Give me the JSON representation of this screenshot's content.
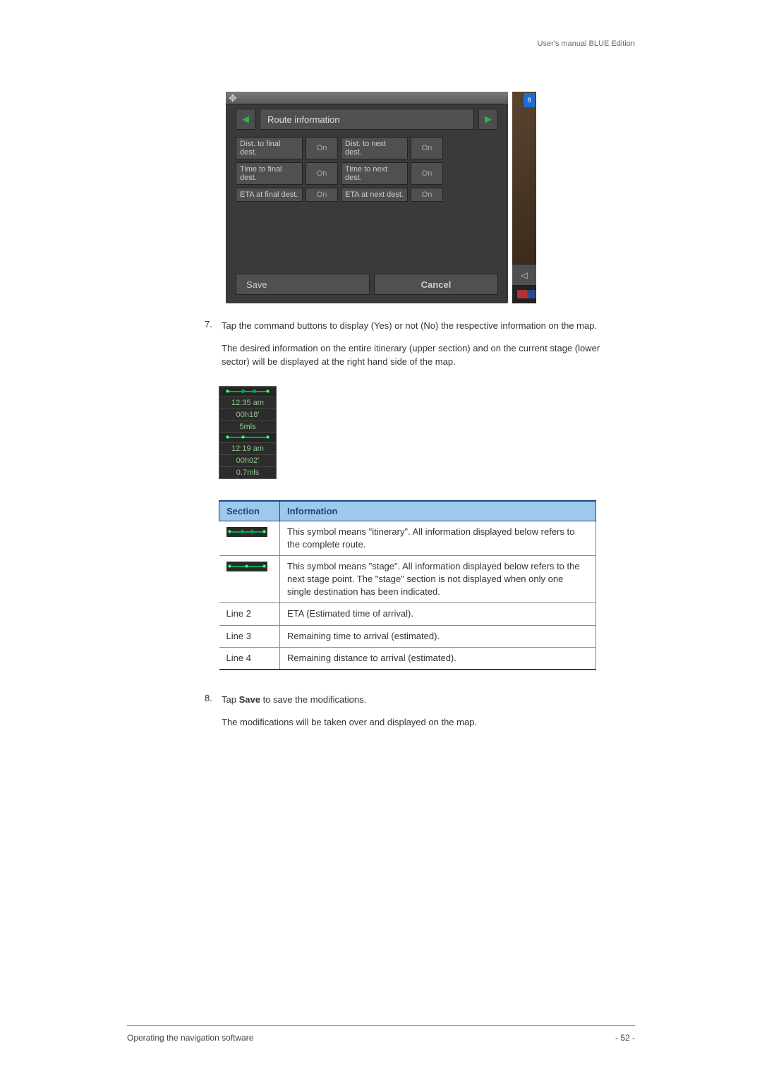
{
  "header_right": "User's manual BLUE Edition",
  "screenshot": {
    "title": "Route information",
    "rows": [
      {
        "l1": "Dist. to final dest.",
        "v1": "On",
        "l2": "Dist. to next dest.",
        "v2": "On"
      },
      {
        "l1": "Time to final dest.",
        "v1": "On",
        "l2": "Time to next dest.",
        "v2": "On"
      },
      {
        "l1": "ETA at final dest.",
        "v1": "On",
        "l2": "ETA at next dest.",
        "v2": "On"
      }
    ],
    "save": "Save",
    "cancel": "Cancel",
    "badge": "8"
  },
  "step7": {
    "num": "7.",
    "p1": "Tap the command buttons to display (Yes) or not (No) the respective information on the map.",
    "p2": "The desired information on the entire itinerary (upper section) and on the current stage (lower sector) will be displayed at the right hand side of the map."
  },
  "strip": {
    "a1": "12:35 am",
    "a2": "00h18'",
    "a3": "5mls",
    "b1": "12:19 am",
    "b2": "00h02'",
    "b3": "0.7mls"
  },
  "table": {
    "h1": "Section",
    "h2": "Information",
    "rows": [
      {
        "section": "",
        "info": "This symbol means \"itinerary\". All information displayed below refers to the complete route."
      },
      {
        "section": "",
        "info": "This symbol means \"stage\". All information displayed below refers to the next stage point. The \"stage\" section is not displayed when only one single destination has been indicated."
      },
      {
        "section": "Line 2",
        "info": "ETA (Estimated time of arrival)."
      },
      {
        "section": "Line 3",
        "info": "Remaining time to arrival (estimated)."
      },
      {
        "section": "Line 4",
        "info": "Remaining distance to arrival (estimated)."
      }
    ]
  },
  "step8": {
    "num": "8.",
    "p1_a": "Tap ",
    "p1_bold": "Save",
    "p1_b": " to save the modifications.",
    "p2": "The modifications will be taken over and displayed on the map."
  },
  "footer": {
    "left": "Operating the navigation software",
    "right": "- 52 -"
  }
}
